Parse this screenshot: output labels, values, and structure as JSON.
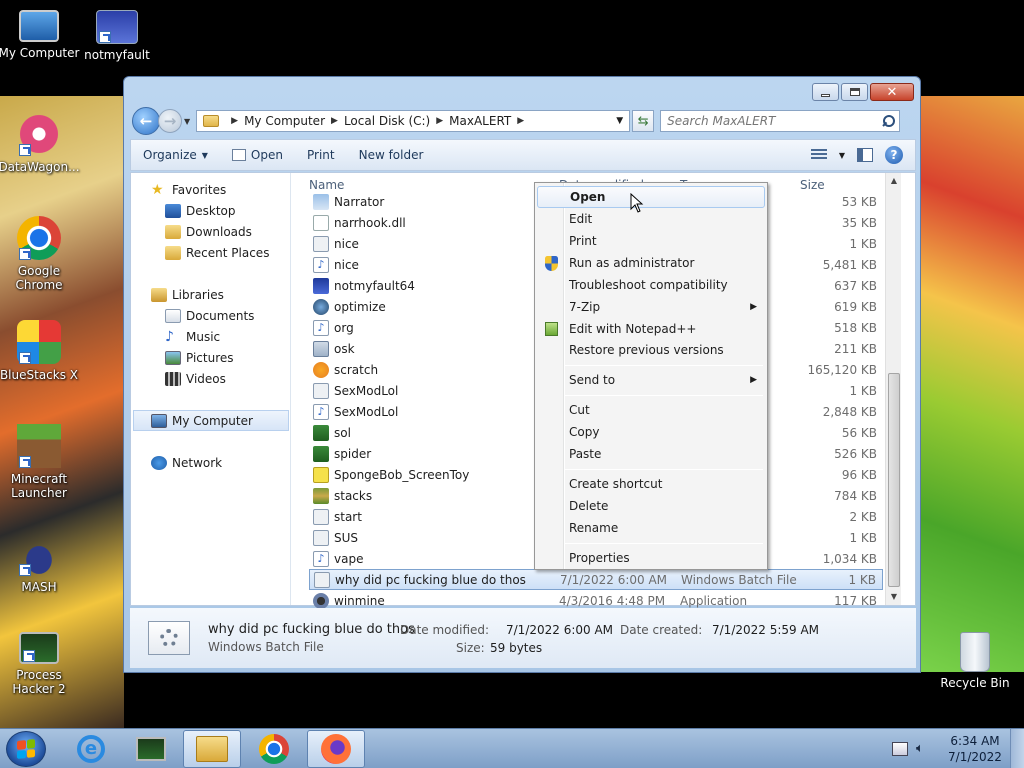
{
  "desktop": {
    "icons": [
      {
        "label": "My Computer"
      },
      {
        "label": "notmyfault"
      },
      {
        "label": "DataWagon..."
      },
      {
        "label": "Google Chrome"
      },
      {
        "label": "BlueStacks X"
      },
      {
        "label": "Minecraft Launcher"
      },
      {
        "label": "MASH"
      },
      {
        "label": "Process Hacker 2"
      },
      {
        "label": "Recycle Bin"
      }
    ]
  },
  "window": {
    "breadcrumb": [
      "My Computer",
      "Local Disk (C:)",
      "MaxALERT"
    ],
    "search_placeholder": "Search MaxALERT",
    "toolbar": {
      "organize": "Organize",
      "open": "Open",
      "print": "Print",
      "new_folder": "New folder"
    },
    "nav": {
      "favorites": "Favorites",
      "fav_items": [
        "Desktop",
        "Downloads",
        "Recent Places"
      ],
      "libraries": "Libraries",
      "lib_items": [
        "Documents",
        "Music",
        "Pictures",
        "Videos"
      ],
      "computer": "My Computer",
      "network": "Network"
    },
    "columns": {
      "name": "Name",
      "date": "Date modified",
      "type": "Type",
      "size": "Size"
    },
    "files": [
      {
        "name": "Narrator",
        "date": "",
        "type": "",
        "size": "53 KB"
      },
      {
        "name": "narrhook.dll",
        "date": "",
        "type": "ens...",
        "size": "35 KB"
      },
      {
        "name": "nice",
        "date": "",
        "type": "File",
        "size": "1 KB"
      },
      {
        "name": "nice",
        "date": "",
        "type": "und",
        "size": "5,481 KB"
      },
      {
        "name": "notmyfault64",
        "date": "",
        "type": "",
        "size": "637 KB"
      },
      {
        "name": "optimize",
        "date": "",
        "type": "",
        "size": "619 KB"
      },
      {
        "name": "org",
        "date": "",
        "type": "",
        "size": "518 KB"
      },
      {
        "name": "osk",
        "date": "",
        "type": "",
        "size": "211 KB"
      },
      {
        "name": "scratch",
        "date": "",
        "type": "",
        "size": "165,120 KB"
      },
      {
        "name": "SexModLol",
        "date": "",
        "type": "File",
        "size": "1 KB"
      },
      {
        "name": "SexModLol",
        "date": "",
        "type": "und",
        "size": "2,848 KB"
      },
      {
        "name": "sol",
        "date": "",
        "type": "",
        "size": "56 KB"
      },
      {
        "name": "spider",
        "date": "",
        "type": "",
        "size": "526 KB"
      },
      {
        "name": "SpongeBob_ScreenToy",
        "date": "",
        "type": "",
        "size": "96 KB"
      },
      {
        "name": "stacks",
        "date": "",
        "type": "",
        "size": "784 KB"
      },
      {
        "name": "start",
        "date": "",
        "type": "File",
        "size": "2 KB"
      },
      {
        "name": "SUS",
        "date": "",
        "type": "File",
        "size": "1 KB"
      },
      {
        "name": "vape",
        "date": "",
        "type": "",
        "size": "1,034 KB"
      },
      {
        "name": "why did pc fucking blue do thos",
        "date": "7/1/2022 6:00 AM",
        "type": "Windows Batch File",
        "size": "1 KB"
      },
      {
        "name": "winmine",
        "date": "4/3/2016 4:48 PM",
        "type": "Application",
        "size": "117 KB"
      }
    ],
    "details": {
      "name": "why did pc fucking blue do thos",
      "type": "Windows Batch File",
      "modified_label": "Date modified:",
      "modified": "7/1/2022 6:00 AM",
      "created_label": "Date created:",
      "created": "7/1/2022 5:59 AM",
      "size_label": "Size:",
      "size": "59 bytes"
    }
  },
  "context_menu": {
    "items": [
      "Open",
      "Edit",
      "Print",
      "Run as administrator",
      "Troubleshoot compatibility",
      "7-Zip",
      "Edit with Notepad++",
      "Restore previous versions",
      "Send to",
      "Cut",
      "Copy",
      "Paste",
      "Create shortcut",
      "Delete",
      "Rename",
      "Properties"
    ]
  },
  "taskbar": {
    "time": "6:34 AM",
    "date": "7/1/2022"
  },
  "colors": {
    "selection": "#cde0f7",
    "accent": "#1e395b"
  }
}
